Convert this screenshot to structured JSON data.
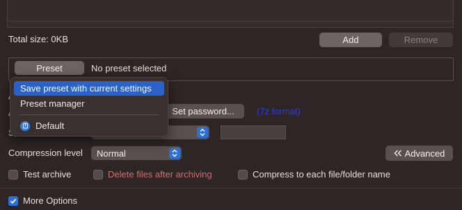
{
  "files": {
    "total_size_label": "Total size: 0KB",
    "add_label": "Add",
    "remove_label": "Remove"
  },
  "preset": {
    "button_label": "Preset",
    "status": "No preset selected",
    "menu": {
      "items": [
        {
          "label": "Save preset with current settings",
          "selected": true
        },
        {
          "label": "Preset manager",
          "selected": false
        }
      ],
      "default_item": {
        "label": "Default",
        "icon": "archive-icon"
      }
    }
  },
  "options": {
    "set_password_label": "Set password...",
    "format_link": "(7z format)",
    "compression_label": "Compression level",
    "compression_value": "Normal",
    "advanced_label": "Advanced",
    "advanced_icon": "double-chevron-left-icon",
    "test_archive": {
      "label": "Test archive",
      "checked": false
    },
    "delete_files": {
      "label": "Delete files after archiving",
      "checked": false
    },
    "compress_each": {
      "label": "Compress to each file/folder name",
      "checked": false
    },
    "more_options": {
      "label": "More Options",
      "checked": true
    }
  },
  "colors": {
    "accent": "#2f6fdc",
    "menu_highlight": "#2a62c9",
    "danger_text": "#e06a6f",
    "link": "#2f3bdc",
    "background": "#2e2624"
  }
}
